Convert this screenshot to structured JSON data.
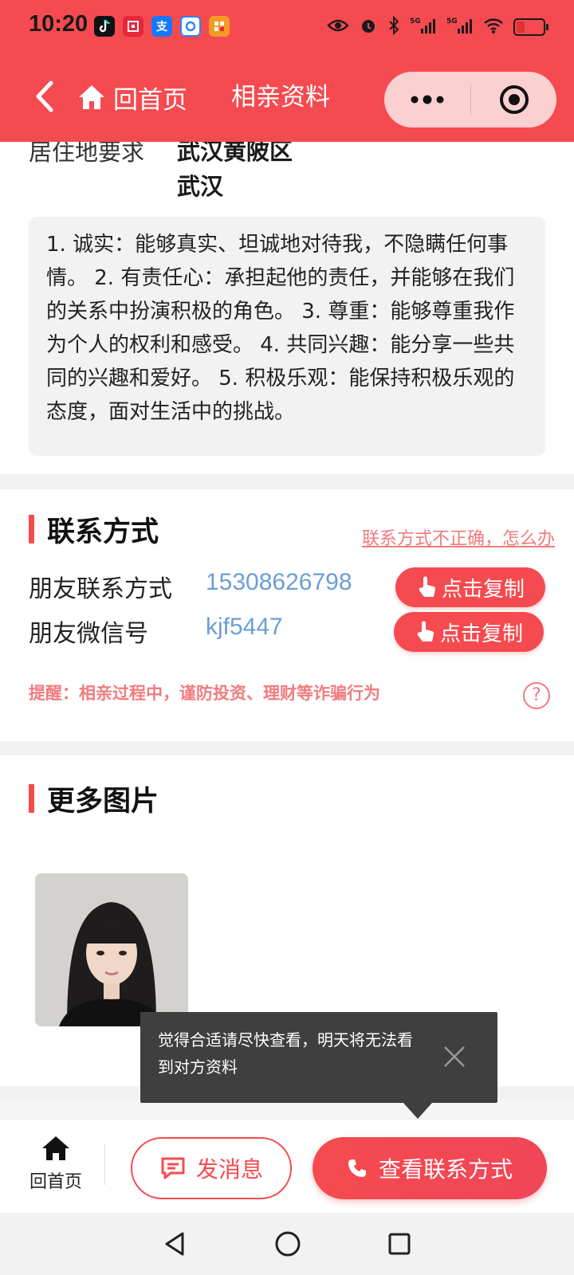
{
  "status_bar": {
    "time": "10:20",
    "apps": [
      {
        "icon": "tiktok-icon",
        "color": "#111111"
      },
      {
        "icon": "bank-icon",
        "color": "#e8263a"
      },
      {
        "icon": "alipay-icon",
        "glyph": "支",
        "color": "#1677ff"
      },
      {
        "icon": "app-blue-icon",
        "color": "#2b86f6"
      },
      {
        "icon": "app-orange-icon",
        "color": "#f59a23"
      }
    ],
    "right_icons": [
      "eye-icon",
      "alarm-icon",
      "bluetooth-icon",
      "signal-5g-icon",
      "signal-5g-icon",
      "wifi-icon",
      "battery-icon"
    ]
  },
  "nav": {
    "home_label": "回首页",
    "title": "相亲资料"
  },
  "residence": {
    "label": "居住地要求",
    "values": [
      "武汉黄陂区",
      "武汉"
    ]
  },
  "description": "1. 诚实：能够真实、坦诚地对待我，不隐瞒任何事情。 2. 有责任心：承担起他的责任，并能够在我们的关系中扮演积极的角色。 3. 尊重：能够尊重我作为个人的权利和感受。 4. 共同兴趣：能分享一些共同的兴趣和爱好。 5. 积极乐观：能保持积极乐观的态度，面对生活中的挑战。",
  "contact": {
    "title": "联系方式",
    "help_link": "联系方式不正确，怎么办",
    "rows": [
      {
        "label": "朋友联系方式",
        "value": "15308626798",
        "copy_label": "点击复制"
      },
      {
        "label": "朋友微信号",
        "value": "kjf5447",
        "copy_label": "点击复制"
      }
    ],
    "warning": "提醒：相亲过程中，谨防投资、理财等诈骗行为",
    "help_glyph": "?"
  },
  "pictures": {
    "title": "更多图片"
  },
  "tooltip": {
    "text": "觉得合适请尽快查看，明天将无法看到对方资料"
  },
  "bottom_bar": {
    "home_label": "回首页",
    "message_label": "发消息",
    "view_contact_label": "查看联系方式"
  },
  "colors": {
    "primary": "#f54a4f",
    "link_blue": "#6b9ed4",
    "warn": "#f27b7e"
  }
}
